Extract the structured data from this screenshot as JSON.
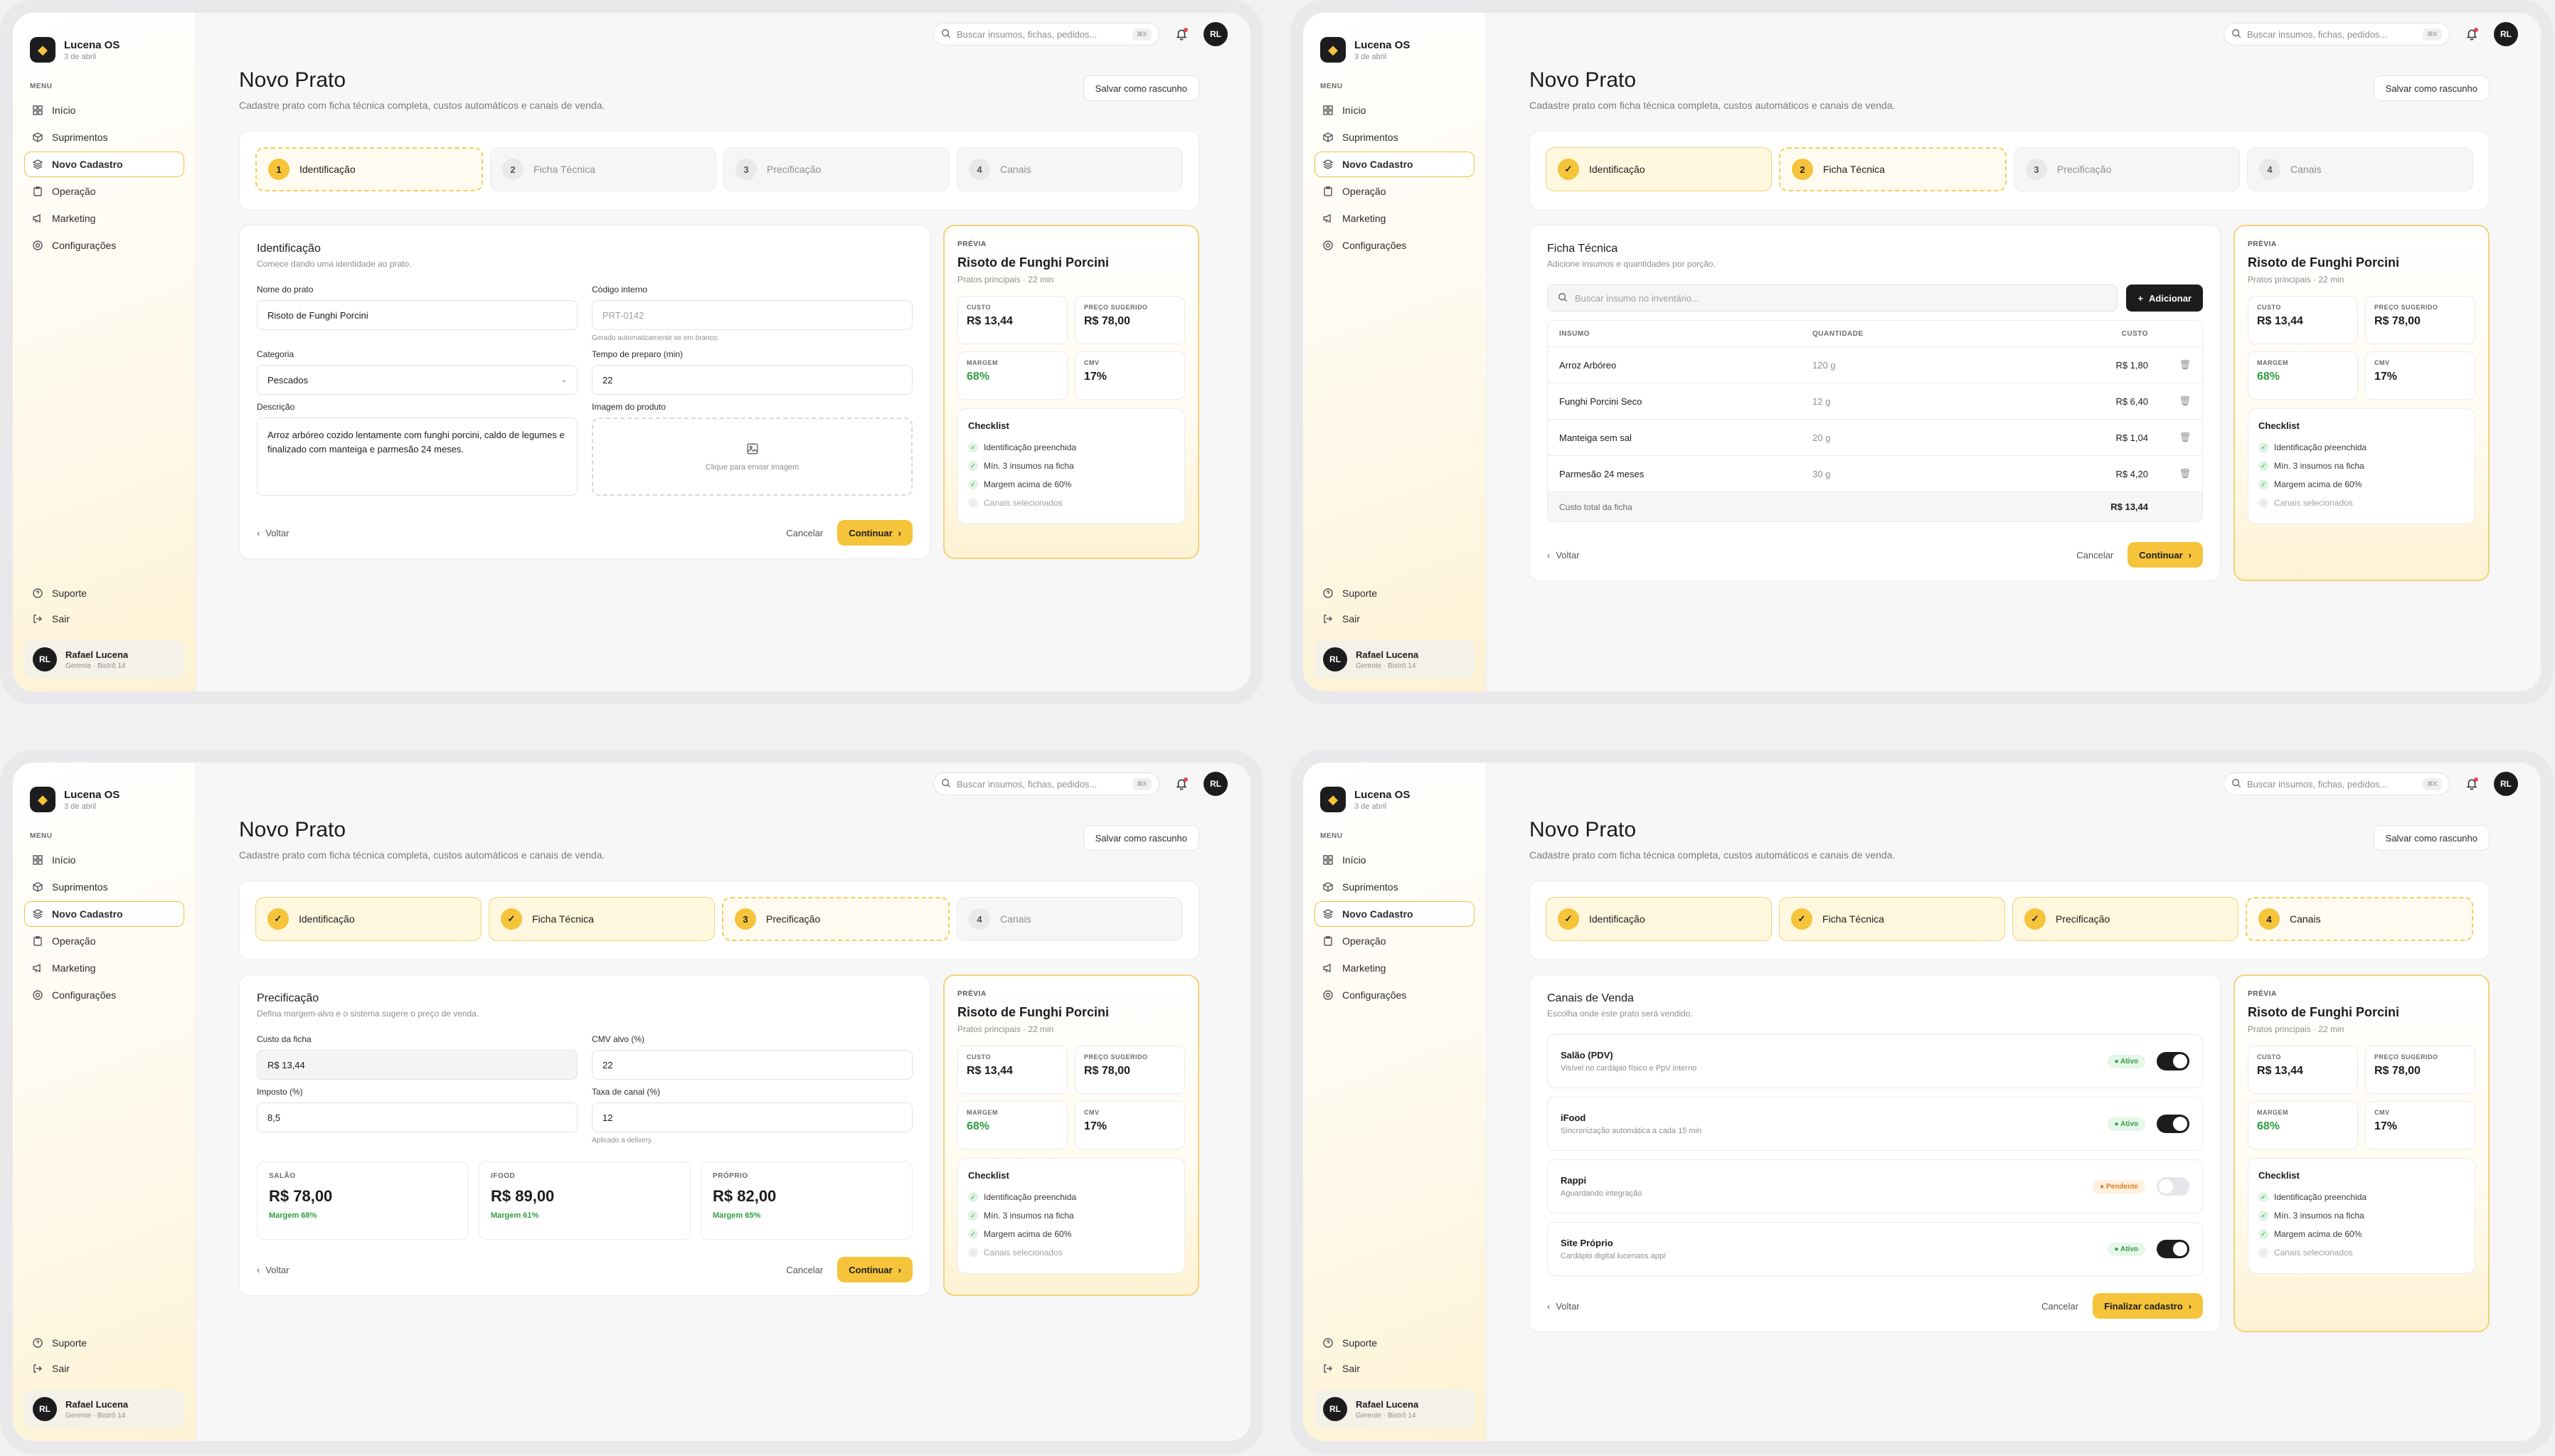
{
  "app": {
    "name": "Lucena OS",
    "date": "3 de abril"
  },
  "sidebar": {
    "menu_label": "MENU",
    "items": [
      {
        "label": "Início",
        "icon": "grid-icon"
      },
      {
        "label": "Suprimentos",
        "icon": "box-icon"
      },
      {
        "label": "Novo Cadastro",
        "icon": "layers-icon",
        "active": true
      },
      {
        "label": "Operação",
        "icon": "clipboard-icon"
      },
      {
        "label": "Marketing",
        "icon": "megaphone-icon"
      },
      {
        "label": "Configurações",
        "icon": "gear-icon"
      }
    ],
    "support": "Suporte",
    "logout": "Sair",
    "user": {
      "initials": "RL",
      "name": "Rafael Lucena",
      "role": "Gerente · Bistrô 14"
    }
  },
  "topbar": {
    "search_placeholder": "Buscar insumos, fichas, pedidos...",
    "shortcut": "⌘K",
    "avatar": "RL"
  },
  "page": {
    "title": "Novo Prato",
    "subtitle": "Cadastre prato com ficha técnica completa, custos automáticos e canais de venda.",
    "draft_button": "Salvar como rascunho"
  },
  "steps": [
    {
      "num": "1",
      "label": "Identificação"
    },
    {
      "num": "2",
      "label": "Ficha Técnica"
    },
    {
      "num": "3",
      "label": "Precificação"
    },
    {
      "num": "4",
      "label": "Canais"
    }
  ],
  "footer": {
    "back": "Voltar",
    "cancel": "Cancelar",
    "continue": "Continuar",
    "finish": "Finalizar cadastro"
  },
  "preview": {
    "label": "PRÉVIA",
    "title": "Risoto de Funghi Porcini",
    "subtitle": "Pratos principais · 22 min",
    "metrics": {
      "cost_label": "CUSTO",
      "cost": "R$ 13,44",
      "price_label": "PREÇO SUGERIDO",
      "price": "R$ 78,00",
      "margin_label": "MARGEM",
      "margin": "68%",
      "cmv_label": "CMV",
      "cmv": "17%"
    },
    "checklist_title": "Checklist",
    "checklist": [
      {
        "label": "Identificação preenchida",
        "done": true
      },
      {
        "label": "Mín. 3 insumos na ficha",
        "done": true
      },
      {
        "label": "Margem acima de 60%",
        "done": true
      },
      {
        "label": "Canais selecionados",
        "done": false
      }
    ]
  },
  "identificacao": {
    "title": "Identificação",
    "subtitle": "Comece dando uma identidade ao prato.",
    "name_label": "Nome do prato",
    "name_value": "Risoto de Funghi Porcini",
    "code_label": "Código interno",
    "code_placeholder": "PRT-0142",
    "code_hint": "Gerado automaticamente se em branco.",
    "category_label": "Categoria",
    "category_value": "Pescados",
    "time_label": "Tempo de preparo (min)",
    "time_value": "22",
    "desc_label": "Descrição",
    "desc_value": "Arroz arbóreo cozido lentamente com funghi porcini, caldo de legumes e finalizado com manteiga e parmesão 24 meses.",
    "image_label": "Imagem do produto",
    "image_hint": "Clique para enviar imagem"
  },
  "ficha": {
    "title": "Ficha Técnica",
    "subtitle": "Adicione insumos e quantidades por porção.",
    "search_placeholder": "Buscar insumo no inventário...",
    "add_button": "Adicionar",
    "columns": [
      "INSUMO",
      "QUANTIDADE",
      "CUSTO"
    ],
    "rows": [
      {
        "name": "Arroz Arbóreo",
        "qty": "120 g",
        "cost": "R$ 1,80"
      },
      {
        "name": "Funghi Porcini Seco",
        "qty": "12 g",
        "cost": "R$ 6,40"
      },
      {
        "name": "Manteiga sem sal",
        "qty": "20 g",
        "cost": "R$ 1,04"
      },
      {
        "name": "Parmesão 24 meses",
        "qty": "30 g",
        "cost": "R$ 4,20"
      }
    ],
    "total_label": "Custo total da ficha",
    "total_value": "R$ 13,44"
  },
  "precificacao": {
    "title": "Precificação",
    "subtitle": "Defina margem-alvo e o sistema sugere o preço de venda.",
    "cost_label": "Custo da ficha",
    "cost_value": "R$ 13,44",
    "cmv_label": "CMV alvo (%)",
    "cmv_value": "22",
    "tax_label": "Imposto (%)",
    "tax_value": "8,5",
    "fee_label": "Taxa de canal (%)",
    "fee_value": "12",
    "fee_hint": "Aplicado a delivery.",
    "prices": [
      {
        "label": "SALÃO",
        "value": "R$ 78,00",
        "margin": "Margem 68%"
      },
      {
        "label": "IFOOD",
        "value": "R$ 89,00",
        "margin": "Margem 61%"
      },
      {
        "label": "PRÓPRIO",
        "value": "R$ 82,00",
        "margin": "Margem 65%"
      }
    ]
  },
  "canais": {
    "title": "Canais de Venda",
    "subtitle": "Escolha onde este prato será vendido.",
    "items": [
      {
        "name": "Salão (PDV)",
        "desc": "Visível no cardápio físico e PpV interno",
        "status": "Ativo",
        "on": true
      },
      {
        "name": "iFood",
        "desc": "Sincronização automática a cada 15 min",
        "status": "Ativo",
        "on": true
      },
      {
        "name": "Rappi",
        "desc": "Aguardando integração",
        "status": "Pendente",
        "on": false
      },
      {
        "name": "Site Próprio",
        "desc": "Cardápio digital lucenaos.app/",
        "status": "Ativo",
        "on": true
      }
    ]
  },
  "colors": {
    "accent": "#f6c43a",
    "success": "#2f9e44",
    "warning": "#d9822b",
    "dark": "#1c1c1e"
  }
}
